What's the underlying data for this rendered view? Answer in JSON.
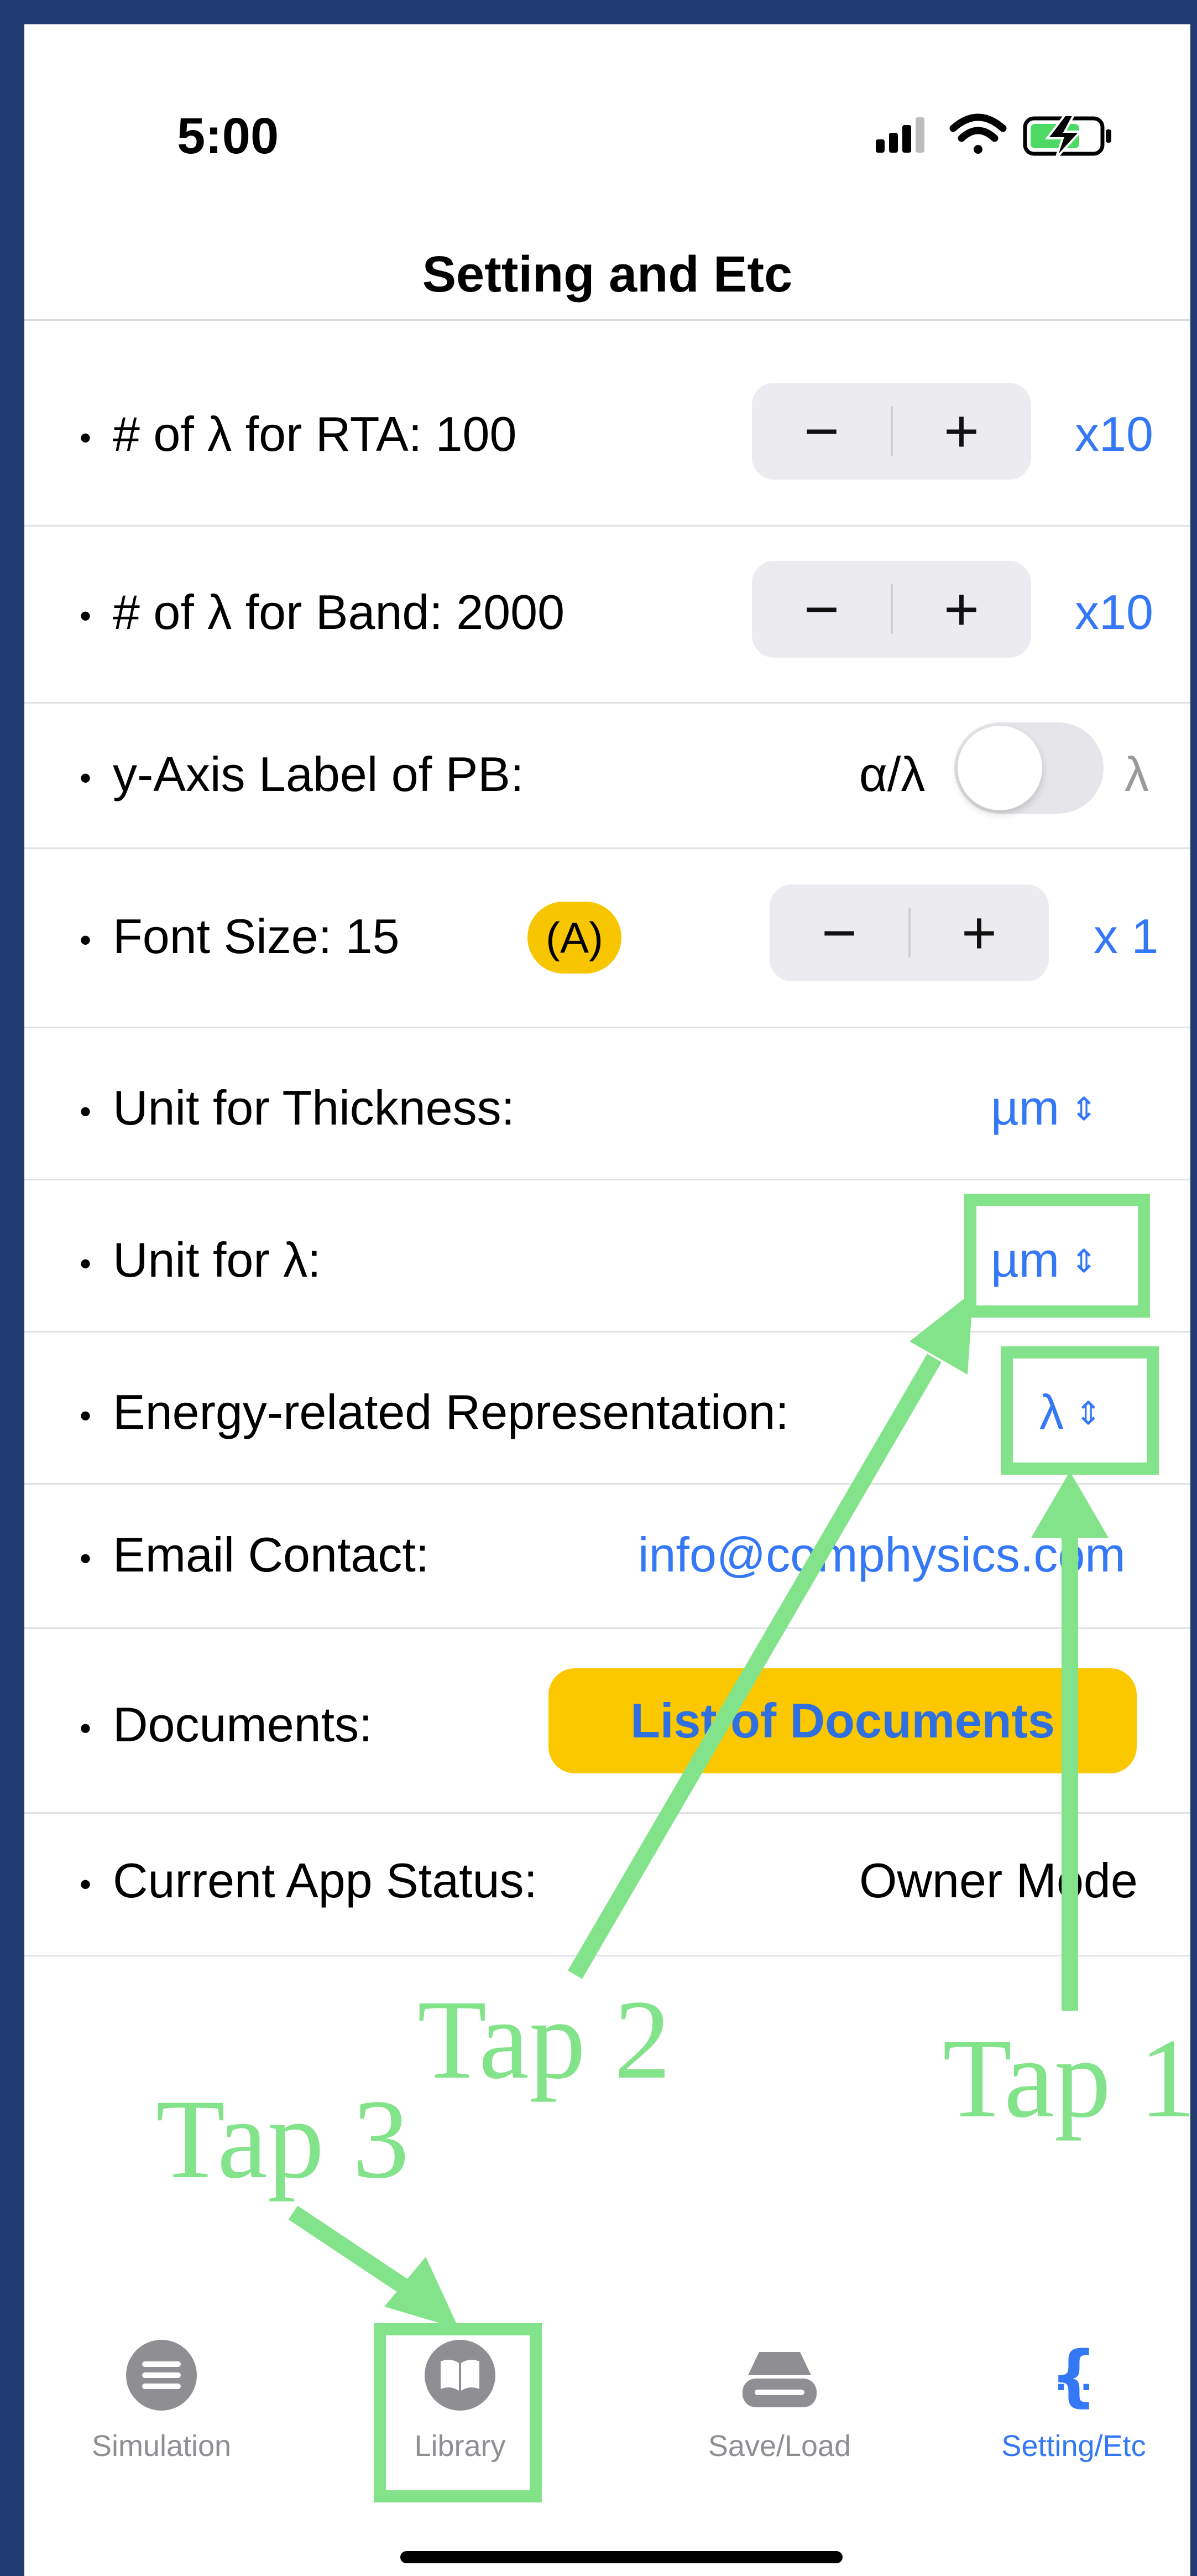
{
  "status_bar": {
    "time": "5:00"
  },
  "nav": {
    "title": "Setting and Etc"
  },
  "settings": {
    "rta": {
      "label": "# of λ for RTA:  100",
      "minus": "−",
      "plus": "+",
      "multiplier": "x10"
    },
    "band": {
      "label": "# of λ for Band:  2000",
      "minus": "−",
      "plus": "+",
      "multiplier": "x10"
    },
    "y_axis": {
      "label": "y-Axis Label of PB:",
      "left_option": "α/λ",
      "right_option": "λ",
      "toggle_on": false
    },
    "font_size": {
      "label": "Font Size: 15",
      "badge": "(A)",
      "minus": "−",
      "plus": "+",
      "multiplier": "x 1"
    },
    "thickness_unit": {
      "label": "Unit for Thickness:",
      "value": "µm"
    },
    "lambda_unit": {
      "label": "Unit for λ:",
      "value": "µm"
    },
    "energy_repr": {
      "label": "Energy-related Representation:",
      "value": "λ"
    },
    "email": {
      "label": "Email Contact:",
      "value": "info@comphysics.com"
    },
    "documents": {
      "label": "Documents:",
      "button": "List of Documents"
    },
    "app_status": {
      "label": "Current App Status:",
      "value": "Owner Mode"
    }
  },
  "tabbar": {
    "tabs": [
      {
        "label": "Simulation",
        "icon": "list-circle-icon",
        "active": false
      },
      {
        "label": "Library",
        "icon": "book-icon",
        "active": false
      },
      {
        "label": "Save/Load",
        "icon": "drive-icon",
        "active": false
      },
      {
        "label": "Setting/Etc",
        "icon": "braces-icon",
        "active": true
      }
    ]
  },
  "annotations": {
    "tap1": "Tap 1",
    "tap2": "Tap 2",
    "tap3": "Tap 3"
  },
  "colors": {
    "accent": "#3478f6",
    "annotation": "#83e38a",
    "button_yellow": "#fbc800",
    "frame": "#1f3a6e"
  }
}
